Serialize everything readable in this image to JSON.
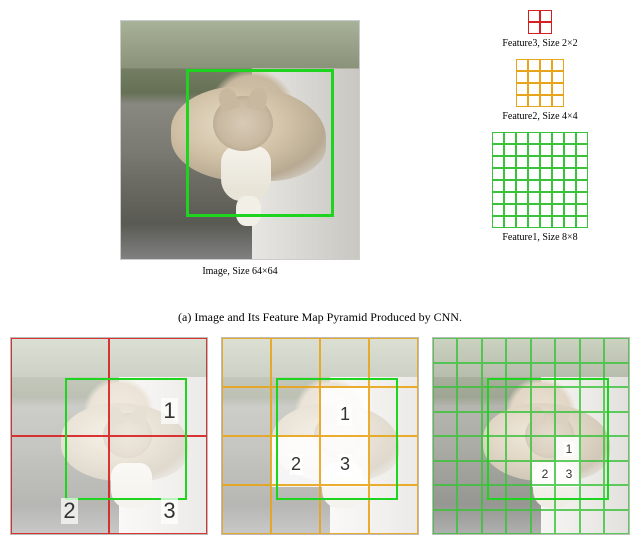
{
  "top": {
    "image_label": "Image, Size 64×64",
    "pyramid": [
      {
        "label": "Feature3, Size 2×2",
        "size": 2,
        "color": "red"
      },
      {
        "label": "Feature2, Size 4×4",
        "size": 4,
        "color": "orange"
      },
      {
        "label": "Feature1, Size 8×8",
        "size": 8,
        "color": "green"
      }
    ]
  },
  "caption_a": "(a) Image and Its Feature Map Pyramid Produced by CNN.",
  "bottom": {
    "thumbs": [
      {
        "grid": 2,
        "numbers": [
          {
            "n": "1",
            "style": "left:150px;top:60px;font-size:22px;"
          },
          {
            "n": "2",
            "style": "left:50px;top:160px;font-size:22px;"
          },
          {
            "n": "3",
            "style": "left:150px;top:160px;font-size:22px;"
          }
        ],
        "highlight_cells": []
      },
      {
        "grid": 4,
        "numbers": [
          {
            "n": "1",
            "style": "left:116px;top:66px;font-size:18px;"
          },
          {
            "n": "2",
            "style": "left:67px;top:116px;font-size:18px;"
          },
          {
            "n": "3",
            "style": "left:116px;top:116px;font-size:18px;"
          }
        ],
        "highlight_cells": [
          {
            "style": "left:99px;top:49.5px;width:49.5px;height:49.5px;"
          },
          {
            "style": "left:49.5px;top:99px;width:49.5px;height:49.5px;"
          },
          {
            "style": "left:99px;top:99px;width:49.5px;height:49.5px;"
          }
        ]
      },
      {
        "grid": 8,
        "numbers": [
          {
            "n": "1",
            "style": "left:131px;top:104px;font-size:12px;"
          },
          {
            "n": "2",
            "style": "left:107px;top:129px;font-size:12px;"
          },
          {
            "n": "3",
            "style": "left:131px;top:129px;font-size:12px;"
          }
        ],
        "highlight_cells": [
          {
            "style": "left:123.75px;top:99px;width:24.75px;height:24.75px;"
          },
          {
            "style": "left:99px;top:123.75px;width:24.75px;height:24.75px;"
          },
          {
            "style": "left:123.75px;top:123.75px;width:24.75px;height:24.75px;"
          }
        ]
      }
    ]
  }
}
